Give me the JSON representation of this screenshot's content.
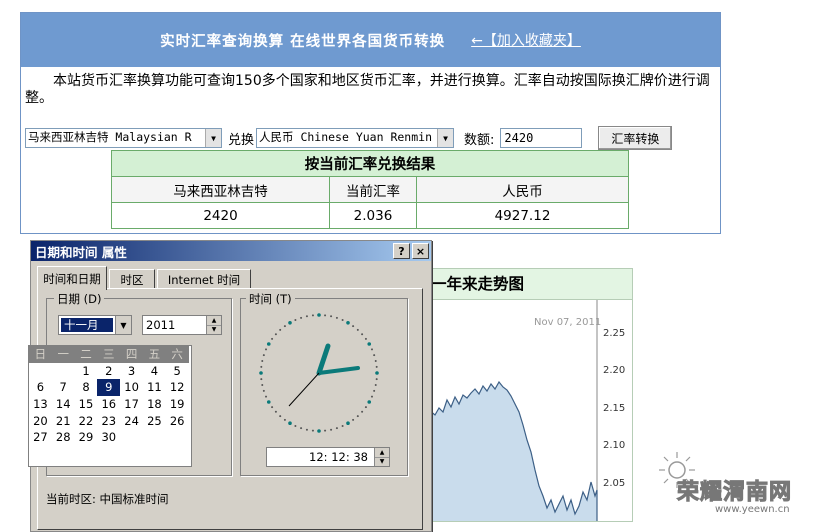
{
  "converter": {
    "title": "实时汇率查询换算  在线世界各国货币转换",
    "favorite_link": "←【加入收藏夹】",
    "description": "本站货币汇率换算功能可查询150多个国家和地区货币汇率，并进行换算。汇率自动按国际换汇牌价进行调整。",
    "from_currency": "马来西亚林吉特 Malaysian R",
    "convert_label": "兑换",
    "to_currency": "人民币 Chinese Yuan Renmin",
    "amount_label": "数额:",
    "amount_value": "2420",
    "convert_button": "汇率转换",
    "result": {
      "caption": "按当前汇率兑换结果",
      "headers": [
        "马来西亚林吉特",
        "当前汇率",
        "人民币"
      ],
      "values": [
        "2420",
        "2.036",
        "4927.12"
      ]
    }
  },
  "trend": {
    "title": "一年来走势图",
    "date_label": "Nov 07, 2011",
    "ticks": [
      "2.25",
      "2.20",
      "2.15",
      "2.10",
      "2.05"
    ]
  },
  "dialog": {
    "title": "日期和时间 属性",
    "help_button": "?",
    "close_button": "×",
    "tabs": [
      "时间和日期",
      "时区",
      "Internet 时间"
    ],
    "date_group": "日期 (D)",
    "time_group": "时间 (T)",
    "month": "十一月",
    "year": "2011",
    "weekdays": [
      "日",
      "一",
      "二",
      "三",
      "四",
      "五",
      "六"
    ],
    "weeks": [
      [
        "",
        "",
        "1",
        "2",
        "3",
        "4",
        "5"
      ],
      [
        "6",
        "7",
        "8",
        "9",
        "10",
        "11",
        "12"
      ],
      [
        "13",
        "14",
        "15",
        "16",
        "17",
        "18",
        "19"
      ],
      [
        "20",
        "21",
        "22",
        "23",
        "24",
        "25",
        "26"
      ],
      [
        "27",
        "28",
        "29",
        "30",
        "",
        "",
        ""
      ]
    ],
    "selected_day": "9",
    "time_value": "12: 12: 38",
    "timezone_label": "当前时区:  中国标准时间"
  },
  "watermark": {
    "text": "荣耀渭南网",
    "url": "www.yeewn.cn"
  },
  "colors": {
    "header_blue": "#6f9ad0",
    "result_green": "#d4f0d4",
    "title_navy": "#0a246a",
    "chart_fill": "#c9dcec"
  }
}
